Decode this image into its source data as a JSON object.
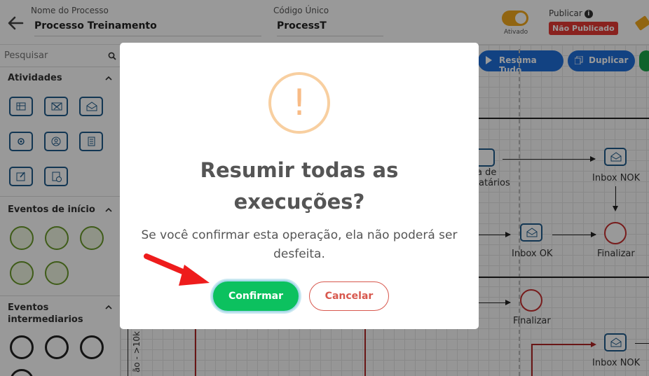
{
  "header": {
    "process_name_label": "Nome do Processo",
    "process_name_value": "Processo Treinamento",
    "unique_code_label": "Código Único",
    "unique_code_value": "ProcessT",
    "toggle_label": "Ativado",
    "toggle_on": true,
    "publish_label": "Publicar",
    "status_badge": "Não Publicado",
    "accent_color": "#f2a81d",
    "badge_color": "#e53935"
  },
  "sidebar": {
    "search_placeholder": "Pesquisar",
    "sections": [
      {
        "title": "Atividades"
      },
      {
        "title": "Eventos de início"
      },
      {
        "title": "Eventos intermediarios"
      }
    ]
  },
  "toolbar": {
    "resume_all_label": "Resuma Tudo",
    "duplicate_label": "Duplicar"
  },
  "diagram": {
    "labels": {
      "partial_a": "a de",
      "partial_b": "atários",
      "inbox_nok_1": "Inbox NOK",
      "inbox_ok": "Inbox OK",
      "finalizar_1": "Finalizar",
      "finalizar_2": "Finalizar",
      "inbox_nok_2": "Inbox NOK",
      "vertical_text": "ão - >10k e"
    }
  },
  "modal": {
    "icon": "warning-icon",
    "title": "Resumir todas as execuções?",
    "message": "Se você confirmar esta operação, ela não poderá ser desfeita.",
    "confirm_label": "Confirmar",
    "cancel_label": "Cancelar",
    "confirm_color": "#0cc15f",
    "cancel_color": "#d8584e"
  }
}
